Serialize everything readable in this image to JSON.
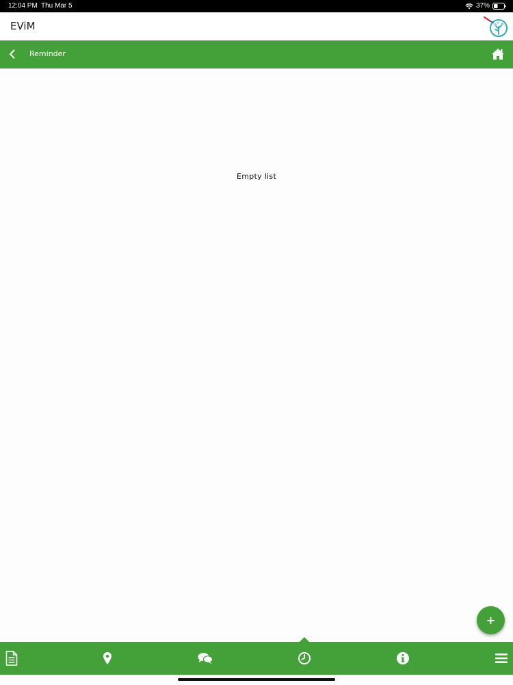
{
  "status_bar": {
    "time": "12:04 PM",
    "date": "Thu Mar 5",
    "battery": "37%"
  },
  "app": {
    "title": "EViM",
    "logo_icon": "evim-logo-icon"
  },
  "nav": {
    "title": "Reminder",
    "back_icon": "chevron-left-icon",
    "home_icon": "home-icon"
  },
  "content": {
    "empty_message": "Empty list"
  },
  "fab": {
    "label": "+"
  },
  "tabs": [
    {
      "name": "documents",
      "icon": "document-icon",
      "active": false
    },
    {
      "name": "location",
      "icon": "map-pin-icon",
      "active": false
    },
    {
      "name": "chat",
      "icon": "chat-bubbles-icon",
      "active": false
    },
    {
      "name": "reminder",
      "icon": "clock-icon",
      "active": true
    },
    {
      "name": "info",
      "icon": "info-icon",
      "active": false
    },
    {
      "name": "menu",
      "icon": "hamburger-menu-icon",
      "active": false
    }
  ],
  "colors": {
    "accent": "#44a038",
    "status_bar": "#000000",
    "background": "#fdfdfd"
  }
}
